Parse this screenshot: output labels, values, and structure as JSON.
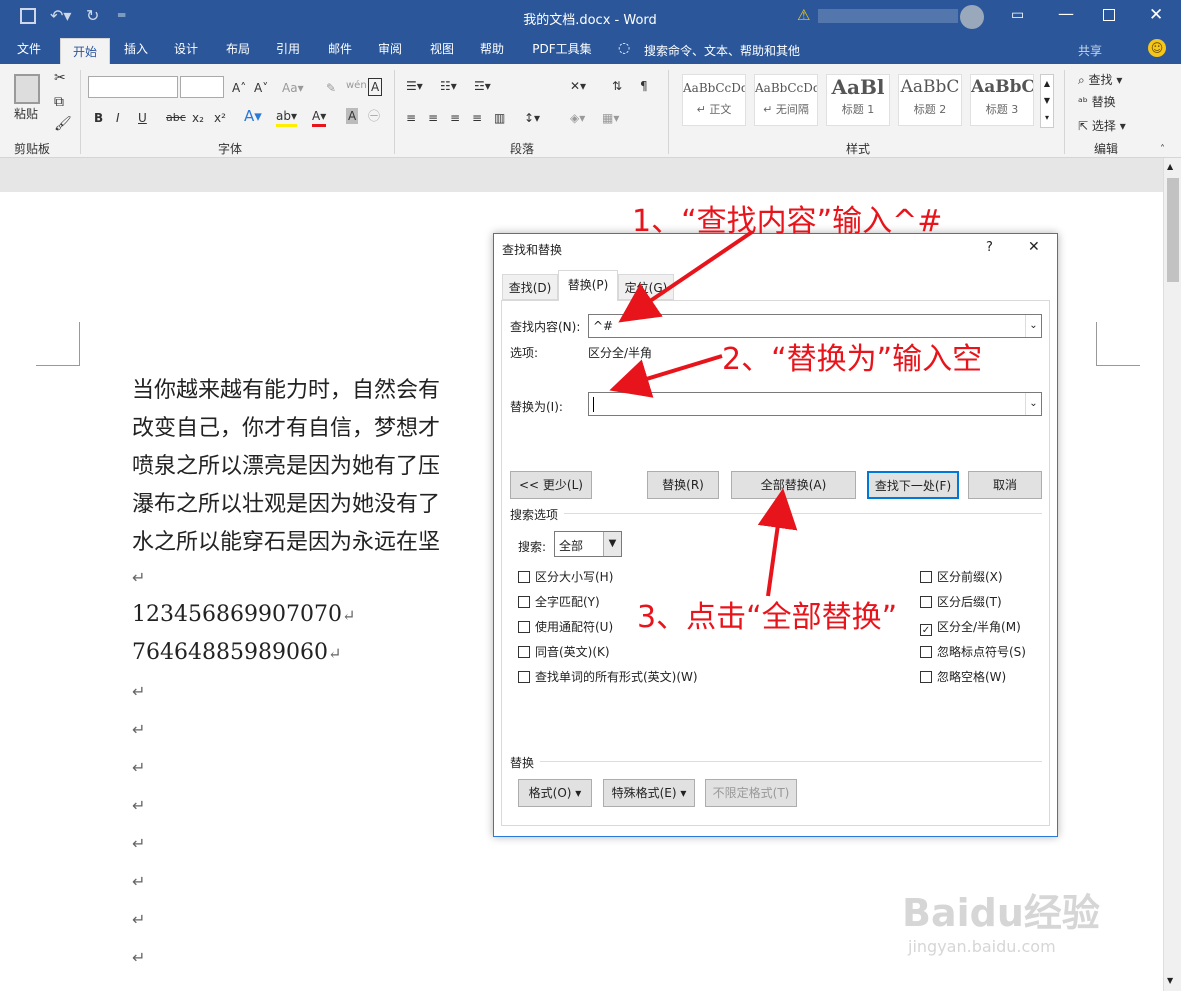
{
  "titlebar": {
    "title": "我的文档.docx - Word",
    "qat": [
      "save",
      "undo",
      "redo",
      "customize"
    ],
    "window_controls": [
      "ribbon-display",
      "minimize",
      "maximize",
      "close"
    ]
  },
  "tabs": [
    {
      "label": "文件"
    },
    {
      "label": "开始"
    },
    {
      "label": "插入"
    },
    {
      "label": "设计"
    },
    {
      "label": "布局"
    },
    {
      "label": "引用"
    },
    {
      "label": "邮件"
    },
    {
      "label": "审阅"
    },
    {
      "label": "视图"
    },
    {
      "label": "帮助"
    },
    {
      "label": "PDF工具集"
    }
  ],
  "tell_me": "搜索命令、文本、帮助和其他",
  "share": "共享",
  "ribbon": {
    "clipboard": {
      "paste": "粘贴",
      "label": "剪贴板"
    },
    "font": {
      "label": "字体",
      "buttons": [
        "B",
        "I",
        "U",
        "abc",
        "x₂",
        "x²"
      ]
    },
    "paragraph": {
      "label": "段落"
    },
    "styles": {
      "label": "样式",
      "items": [
        {
          "preview": "AaBbCcDd",
          "name": "↵ 正文"
        },
        {
          "preview": "AaBbCcDd",
          "name": "↵ 无间隔"
        },
        {
          "preview": "AaBl",
          "name": "标题 1"
        },
        {
          "preview": "AaBbC",
          "name": "标题 2"
        },
        {
          "preview": "AaBbC",
          "name": "标题 3"
        }
      ]
    },
    "editing": {
      "label": "编辑",
      "find": "查找",
      "replace": "替换",
      "select": "选择"
    }
  },
  "document": {
    "lines": [
      "当你越来越有能力时，自然会有",
      "改变自己，你才有自信，梦想才",
      "喷泉之所以漂亮是因为她有了压",
      "瀑布之所以壮观是因为她没有了",
      "水之所以能穿石是因为永远在坚"
    ],
    "numbers": [
      "123456869907070",
      "76464885989060"
    ],
    "para_mark": "↵"
  },
  "dialog": {
    "title": "查找和替换",
    "help": "?",
    "close": "✕",
    "tabs": [
      "查找(D)",
      "替换(P)",
      "定位(G)"
    ],
    "find_label": "查找内容(N):",
    "find_value": "^#",
    "options_label": "选项:",
    "options_value": "区分全/半角",
    "replace_label": "替换为(I):",
    "replace_value": "",
    "buttons": {
      "less": "<< 更少(L)",
      "replace": "替换(R)",
      "replace_all": "全部替换(A)",
      "find_next": "查找下一处(F)",
      "cancel": "取消"
    },
    "search_options": "搜索选项",
    "search_label": "搜索:",
    "search_value": "全部",
    "left_checks": [
      {
        "label": "区分大小写(H)",
        "checked": false
      },
      {
        "label": "全字匹配(Y)",
        "checked": false
      },
      {
        "label": "使用通配符(U)",
        "checked": false
      },
      {
        "label": "同音(英文)(K)",
        "checked": false
      },
      {
        "label": "查找单词的所有形式(英文)(W)",
        "checked": false
      }
    ],
    "right_checks": [
      {
        "label": "区分前缀(X)",
        "checked": false
      },
      {
        "label": "区分后缀(T)",
        "checked": false
      },
      {
        "label": "区分全/半角(M)",
        "checked": true
      },
      {
        "label": "忽略标点符号(S)",
        "checked": false
      },
      {
        "label": "忽略空格(W)",
        "checked": false
      }
    ],
    "replace_section": "替换",
    "format_btn": "格式(O) ▾",
    "special_btn": "特殊格式(E) ▾",
    "noformat_btn": "不限定格式(T)"
  },
  "annotations": [
    "1、“查找内容”输入^#",
    "2、“替换为”输入空",
    "3、点击“全部替换”"
  ],
  "watermark": {
    "brand": "Baidu经验",
    "url": "jingyan.baidu.com"
  },
  "colors": {
    "word_blue": "#2b579a",
    "annotation_red": "#e8141b",
    "dialog_border": "#2b79d8"
  }
}
